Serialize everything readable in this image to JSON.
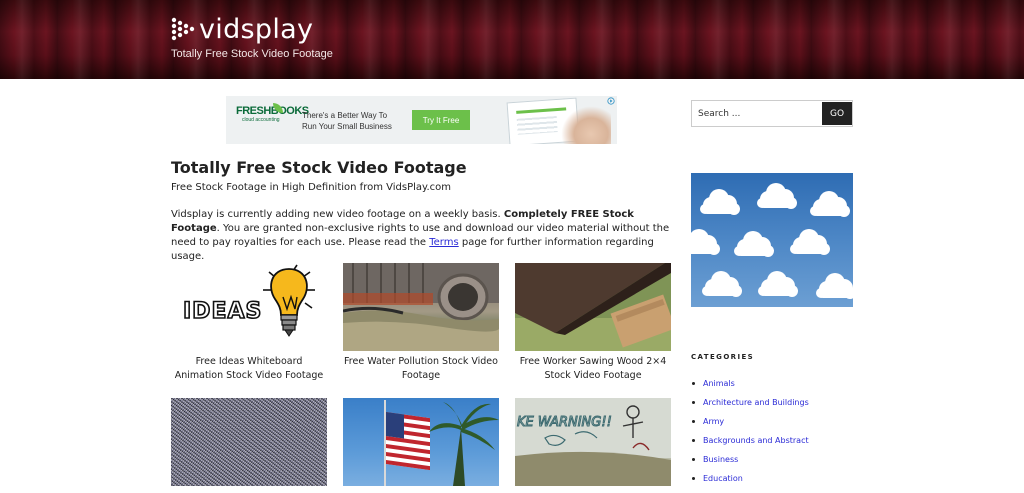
{
  "header": {
    "site_name": "vidsplay",
    "tagline": "Totally Free Stock Video Footage"
  },
  "ad": {
    "brand": "FRESHBOOKS",
    "brand_sub": "cloud accounting",
    "copy_line1": "There's a Better Way To",
    "copy_line2": "Run Your Small Business",
    "cta": "Try It Free"
  },
  "main": {
    "title": "Totally Free Stock Video Footage",
    "subtitle": "Free Stock Footage in High Definition from VidsPlay.com",
    "intro_part1": "Vidsplay is currently adding new video footage on a weekly basis.",
    "intro_bold": "Completely FREE Stock Footage",
    "intro_part2": ". You are granted non-exclusive rights to use and download our video material without the need to pay royalties for each use. Please read the",
    "intro_link": "Terms",
    "intro_part3": "page for further information regarding usage.",
    "videos": [
      {
        "caption": "Free Ideas Whiteboard Animation Stock Video Footage",
        "thumb_text": "IDEAS"
      },
      {
        "caption": "Free Water Pollution Stock Video Footage"
      },
      {
        "caption": "Free Worker Sawing Wood 2×4 Stock Video Footage"
      },
      {
        "caption": ""
      },
      {
        "caption": ""
      },
      {
        "caption": "",
        "thumb_text": "KE WARNING!!"
      }
    ]
  },
  "sidebar": {
    "search_placeholder": "Search ...",
    "search_button": "GO",
    "categories_heading": "CATEGORIES",
    "categories": [
      "Animals",
      "Architecture and Buildings",
      "Army",
      "Backgrounds and Abstract",
      "Business",
      "Education"
    ]
  },
  "colors": {
    "link": "#2b2bd6",
    "header_red": "#6b1420",
    "button_dark": "#222222",
    "ad_green": "#6cc04a"
  }
}
